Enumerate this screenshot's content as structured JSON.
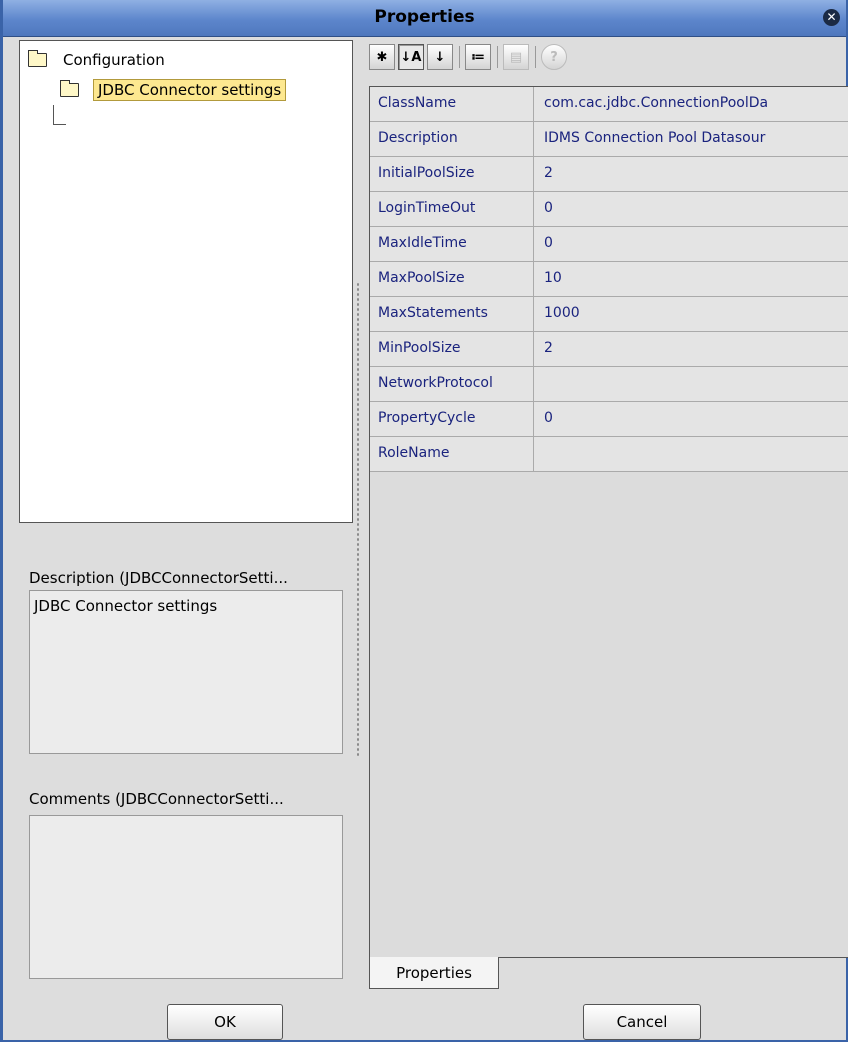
{
  "window": {
    "title": "Properties",
    "close_icon": "close-icon",
    "accent": "#5d86cc"
  },
  "tree": {
    "root": {
      "label": "Configuration",
      "icon": "folder-icon"
    },
    "child": {
      "label": "JDBC Connector settings",
      "icon": "folder-icon",
      "selected": true
    }
  },
  "description": {
    "label": "Description (JDBCConnectorSetti...",
    "text": "JDBC Connector settings"
  },
  "comments": {
    "label": "Comments (JDBCConnectorSetti...",
    "text": ""
  },
  "toolbar": {
    "buttons": [
      {
        "icon": "unsorted-icon",
        "glyph": "✱",
        "state": "normal"
      },
      {
        "icon": "sort-alphabetical-icon",
        "glyph": "↓A",
        "state": "pressed"
      },
      {
        "icon": "sort-by-type-icon",
        "glyph": "↓",
        "state": "normal"
      },
      {
        "icon": "show-changed-icon",
        "glyph": "≔",
        "state": "normal"
      },
      {
        "icon": "property-sheet-icon",
        "glyph": "▤",
        "state": "disabled"
      },
      {
        "icon": "help-icon",
        "glyph": "?",
        "state": "disabled"
      }
    ]
  },
  "properties": [
    {
      "name": "ClassName",
      "value": "com.cac.jdbc.ConnectionPoolDa"
    },
    {
      "name": "Description",
      "value": "IDMS Connection Pool Datasour"
    },
    {
      "name": "InitialPoolSize",
      "value": "2"
    },
    {
      "name": "LoginTimeOut",
      "value": "0"
    },
    {
      "name": "MaxIdleTime",
      "value": "0"
    },
    {
      "name": "MaxPoolSize",
      "value": "10"
    },
    {
      "name": "MaxStatements",
      "value": "1000"
    },
    {
      "name": "MinPoolSize",
      "value": "2"
    },
    {
      "name": "NetworkProtocol",
      "value": ""
    },
    {
      "name": "PropertyCycle",
      "value": "0"
    },
    {
      "name": "RoleName",
      "value": ""
    }
  ],
  "tab": {
    "label": "Properties"
  },
  "buttons": {
    "ok": "OK",
    "cancel": "Cancel"
  }
}
